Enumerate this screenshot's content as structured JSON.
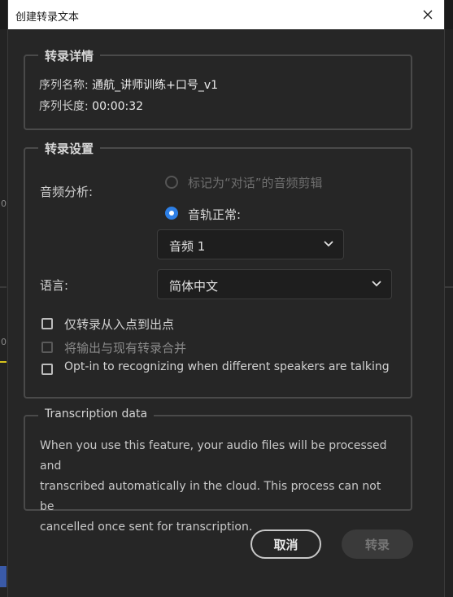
{
  "window": {
    "title": "创建转录文本"
  },
  "background": {
    "mark_a": "0",
    "mark_b": "0"
  },
  "details": {
    "legend": "转录详情",
    "sequence_name_label": "序列名称:",
    "sequence_name_value": "通航_讲师训练+口号_v1",
    "sequence_length_label": "序列长度:",
    "sequence_length_value": "00:00:32"
  },
  "settings": {
    "legend": "转录设置",
    "audio_analysis_label": "音频分析:",
    "radio_dialogue_label": "标记为“对话”的音频剪辑",
    "radio_dialogue_selected": false,
    "radio_track_label": "音轨正常:",
    "radio_track_selected": true,
    "track_select_value": "音频 1",
    "language_label": "语言:",
    "language_select_value": "简体中文",
    "checkbox_inout_label": "仅转录从入点到出点",
    "checkbox_inout_checked": false,
    "checkbox_merge_label": "将输出与现有转录合并",
    "checkbox_merge_enabled": false,
    "checkbox_speakers_label": "Opt-in to recognizing when different speakers are talking",
    "checkbox_speakers_checked": false
  },
  "transcription": {
    "legend": "Transcription data",
    "line1": "When you use this feature, your audio files will be processed and",
    "line2": "transcribed automatically in the cloud. This process can not be",
    "line3": "cancelled once sent for transcription."
  },
  "actions": {
    "cancel_label": "取消",
    "transcribe_label": "转录"
  },
  "colors": {
    "accent": "#2d7fe6",
    "dialog_bg": "#262626",
    "titlebar_bg": "#ffffff"
  }
}
